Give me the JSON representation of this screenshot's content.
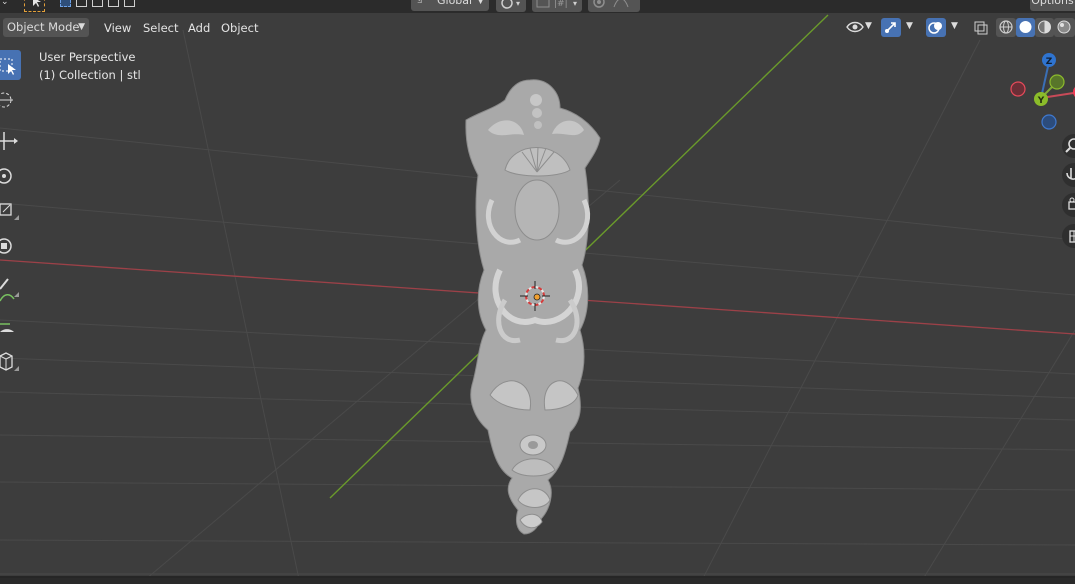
{
  "topbar": {
    "orientation_label": "Global",
    "options_label": "Options"
  },
  "header": {
    "mode_label": "Object Mode",
    "menus": [
      "View",
      "Select",
      "Add",
      "Object"
    ]
  },
  "viewport_info": {
    "line1": "User Perspective",
    "line2": "(1) Collection | stl"
  },
  "gizmo": {
    "z_label": "Z",
    "y_label": "Y",
    "colors": {
      "x": "#ef3b55",
      "y": "#8bbc2a",
      "z": "#2f74d0"
    }
  },
  "colors": {
    "background": "#3d3d3d",
    "accent": "#4772b3",
    "x_axis": "#b3474e",
    "y_axis": "#6c9a2e",
    "grid": "#4b4b4b",
    "model": "#b8b8b8"
  },
  "icons": {
    "left_toolbar": [
      "select-box-icon",
      "cursor-icon",
      "move-icon",
      "rotate-icon",
      "scale-icon",
      "transform-icon",
      "annotate-icon",
      "measure-icon",
      "add-cube-icon"
    ],
    "right_nav": [
      "zoom-icon",
      "pan-icon",
      "camera-icon",
      "grid-view-icon"
    ]
  }
}
